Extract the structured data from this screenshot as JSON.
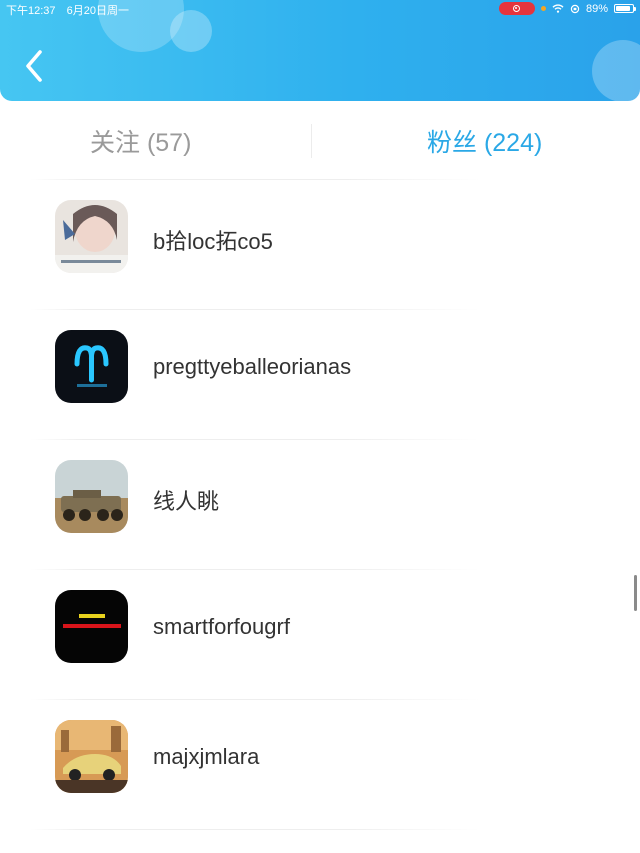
{
  "status_bar": {
    "time": "下午12:37",
    "date": "6月20日周一",
    "battery": "89%",
    "battery_level": 0.89
  },
  "header": {
    "back_icon": "chevron-left-icon"
  },
  "tabs": [
    {
      "label": "关注 (57)",
      "active": false
    },
    {
      "label": "粉丝 (224)",
      "active": true
    }
  ],
  "colors": {
    "header_start": "#46c6f2",
    "header_end": "#2aa2ea",
    "active_tab": "#2aa8e6",
    "inactive_tab": "#9a9a9a",
    "name_text": "#333333"
  },
  "fans": [
    {
      "name": "b拾loc拓co5",
      "avatar": "portrait-photo"
    },
    {
      "name": "pregttyeballeorianas",
      "avatar": "aries-logo"
    },
    {
      "name": "线人眺",
      "avatar": "armored-vehicle-photo"
    },
    {
      "name": "smartforfougrf",
      "avatar": "red-text-graphic"
    },
    {
      "name": "majxjmlara",
      "avatar": "sports-car-photo"
    }
  ]
}
